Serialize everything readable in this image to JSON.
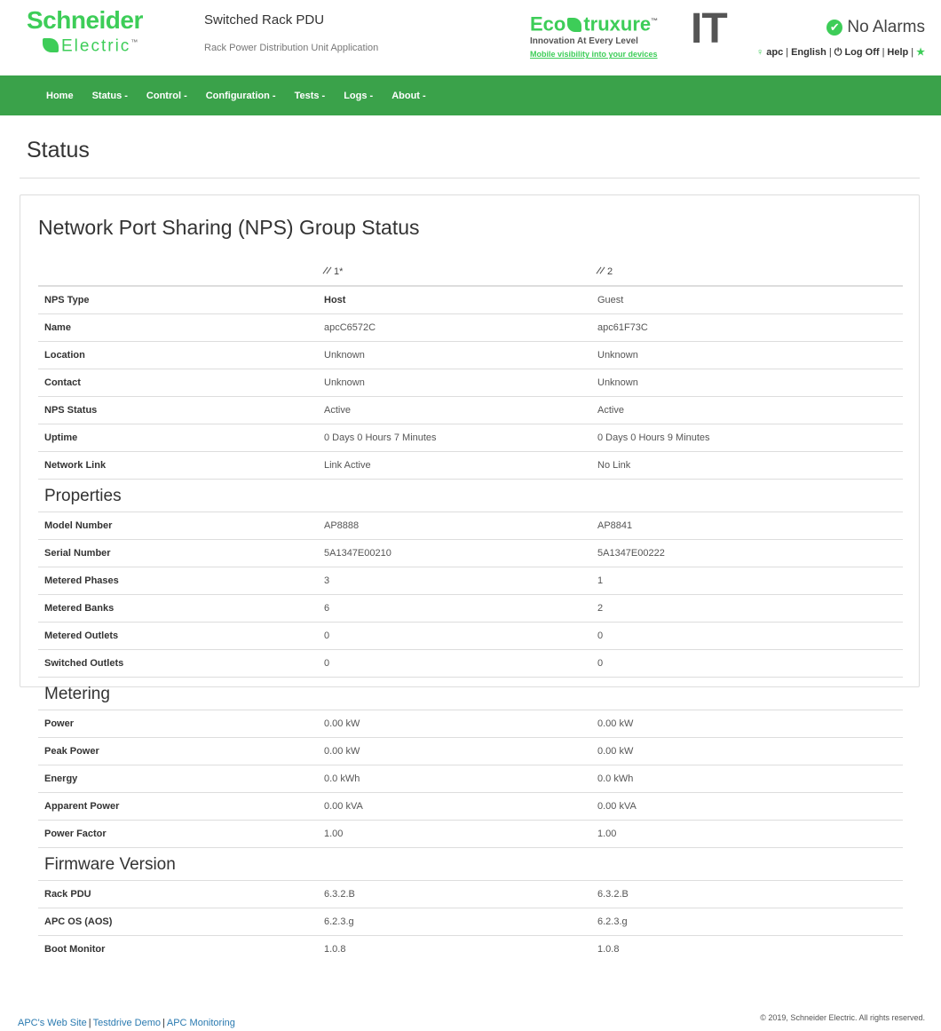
{
  "header": {
    "logo_top": "Schneider",
    "logo_bottom": "Electric",
    "app_title": "Switched Rack PDU",
    "app_subtitle": "Rack Power Distribution Unit Application",
    "eco_word_a": "Eco",
    "eco_word_b": "truxure",
    "eco_tagline": "Innovation At Every Level",
    "eco_link": "Mobile visibility into your devices",
    "it_label": "IT",
    "alarm_status": "No Alarms",
    "user": "apc",
    "language": "English",
    "logoff": "Log Off",
    "help": "Help",
    "brand_green": "#3dcd58"
  },
  "nav": {
    "items": [
      "Home",
      "Status -",
      "Control -",
      "Configuration -",
      "Tests -",
      "Logs -",
      "About -"
    ],
    "bg_color": "#3aa24a"
  },
  "page": {
    "title": "Status"
  },
  "panel": {
    "title": "Network Port Sharing (NPS)  Group Status",
    "col2_head": "1*",
    "col3_head": "2",
    "rows": [
      [
        "NPS Type",
        "Host",
        "Guest"
      ],
      [
        "Name",
        "apcC6572C",
        "apc61F73C"
      ],
      [
        "Location",
        "Unknown",
        "Unknown"
      ],
      [
        "Contact",
        "Unknown",
        "Unknown"
      ],
      [
        "NPS Status",
        "Active",
        "Active"
      ],
      [
        "Uptime",
        "0 Days 0 Hours 7 Minutes",
        "0 Days 0 Hours 9 Minutes"
      ],
      [
        "Network Link",
        "Link Active",
        "No Link"
      ]
    ],
    "properties_title": "Properties",
    "properties": [
      [
        "Model Number",
        "AP8888",
        "AP8841"
      ],
      [
        "Serial Number",
        "5A1347E00210",
        "5A1347E00222"
      ],
      [
        "Metered Phases",
        "3",
        "1"
      ],
      [
        "Metered Banks",
        "6",
        "2"
      ],
      [
        "Metered Outlets",
        "0",
        "0"
      ],
      [
        "Switched Outlets",
        "0",
        "0"
      ]
    ],
    "metering_title": "Metering",
    "metering": [
      [
        "Power",
        "0.00 kW",
        "0.00 kW"
      ],
      [
        "Peak Power",
        "0.00 kW",
        "0.00 kW"
      ],
      [
        "Energy",
        "0.0 kWh",
        "0.0 kWh"
      ],
      [
        "Apparent Power",
        "0.00 kVA",
        "0.00 kVA"
      ],
      [
        "Power Factor",
        "1.00",
        "1.00"
      ]
    ],
    "firmware_title": "Firmware Version",
    "firmware": [
      [
        "Rack PDU",
        "6.3.2.B",
        "6.3.2.B"
      ],
      [
        "APC OS (AOS)",
        "6.2.3.g",
        "6.2.3.g"
      ],
      [
        "Boot Monitor",
        "1.0.8",
        "1.0.8"
      ]
    ]
  },
  "footer": {
    "links": [
      "APC's Web Site",
      "Testdrive Demo",
      "APC Monitoring"
    ],
    "copyright": "© 2019, Schneider Electric. All rights reserved."
  }
}
